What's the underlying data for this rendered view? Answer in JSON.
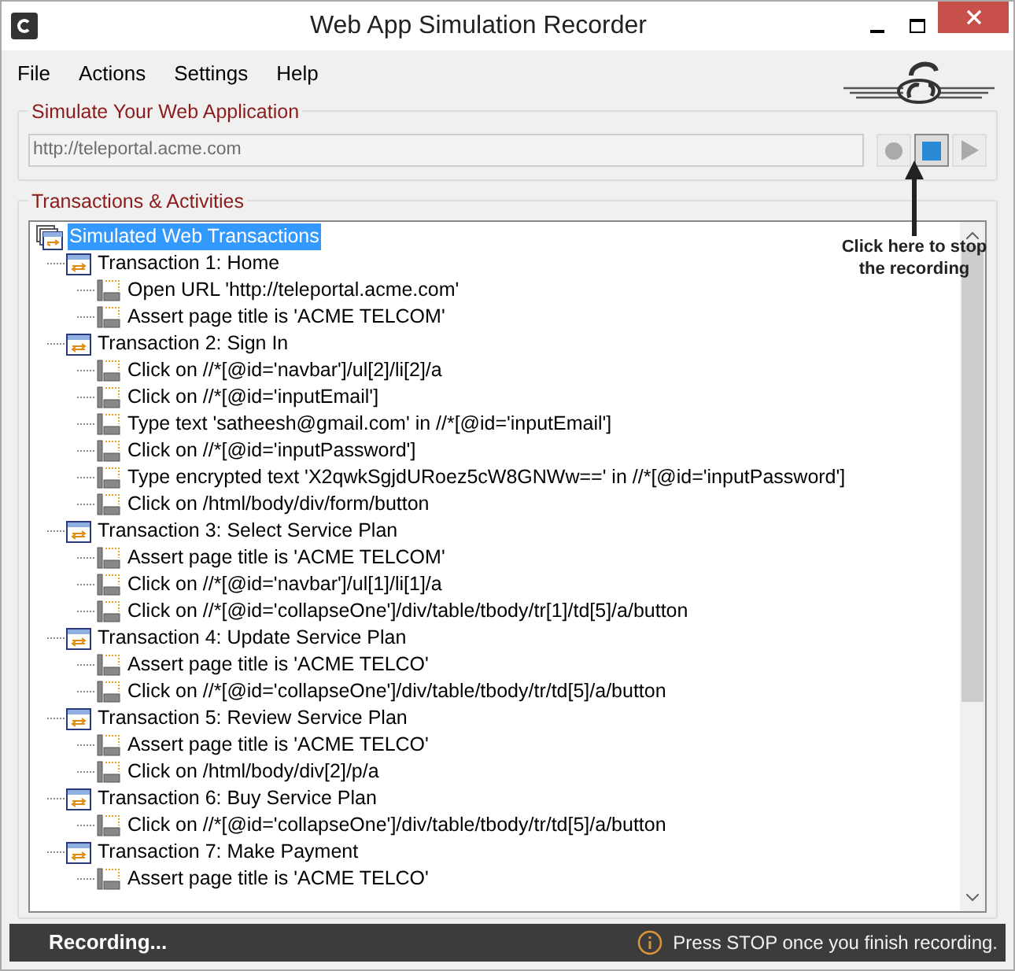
{
  "window": {
    "title": "Web App Simulation Recorder"
  },
  "menu": [
    "File",
    "Actions",
    "Settings",
    "Help"
  ],
  "simulate_group": {
    "title": "Simulate Your Web Application",
    "url": "http://teleportal.acme.com",
    "buttons": [
      {
        "kind": "record",
        "disabled": true
      },
      {
        "kind": "stop",
        "disabled": false
      },
      {
        "kind": "play",
        "disabled": true
      }
    ]
  },
  "callout": {
    "text": "Click here to stop the recording"
  },
  "transactions_group": {
    "title": "Transactions & Activities",
    "tree": {
      "label": "Simulated Web Transactions",
      "selected": true,
      "children": [
        {
          "label": "Transaction 1: Home",
          "children": [
            {
              "label": "Open URL 'http://teleportal.acme.com'"
            },
            {
              "label": "Assert page title is 'ACME TELCOM'"
            }
          ]
        },
        {
          "label": "Transaction 2: Sign In",
          "children": [
            {
              "label": "Click on //*[@id='navbar']/ul[2]/li[2]/a"
            },
            {
              "label": "Click on //*[@id='inputEmail']"
            },
            {
              "label": "Type text 'satheesh@gmail.com' in //*[@id='inputEmail']"
            },
            {
              "label": "Click on //*[@id='inputPassword']"
            },
            {
              "label": "Type encrypted text 'X2qwkSgjdURoez5cW8GNWw==' in //*[@id='inputPassword']"
            },
            {
              "label": "Click on /html/body/div/form/button"
            }
          ]
        },
        {
          "label": "Transaction 3: Select Service Plan",
          "children": [
            {
              "label": "Assert page title is 'ACME TELCOM'"
            },
            {
              "label": "Click on //*[@id='navbar']/ul[1]/li[1]/a"
            },
            {
              "label": "Click on //*[@id='collapseOne']/div/table/tbody/tr[1]/td[5]/a/button"
            }
          ]
        },
        {
          "label": "Transaction 4: Update Service Plan",
          "children": [
            {
              "label": "Assert page title is 'ACME TELCO'"
            },
            {
              "label": "Click on //*[@id='collapseOne']/div/table/tbody/tr/td[5]/a/button"
            }
          ]
        },
        {
          "label": "Transaction 5: Review Service Plan",
          "children": [
            {
              "label": "Assert page title is 'ACME TELCO'"
            },
            {
              "label": "Click on /html/body/div[2]/p/a"
            }
          ]
        },
        {
          "label": "Transaction 6: Buy Service Plan",
          "children": [
            {
              "label": "Click on //*[@id='collapseOne']/div/table/tbody/tr/td[5]/a/button"
            }
          ]
        },
        {
          "label": "Transaction 7: Make Payment",
          "children": [
            {
              "label": "Assert page title is 'ACME TELCO'"
            }
          ]
        }
      ]
    }
  },
  "status_bar": {
    "status": "Recording...",
    "hint": "Press STOP once you finish recording."
  }
}
